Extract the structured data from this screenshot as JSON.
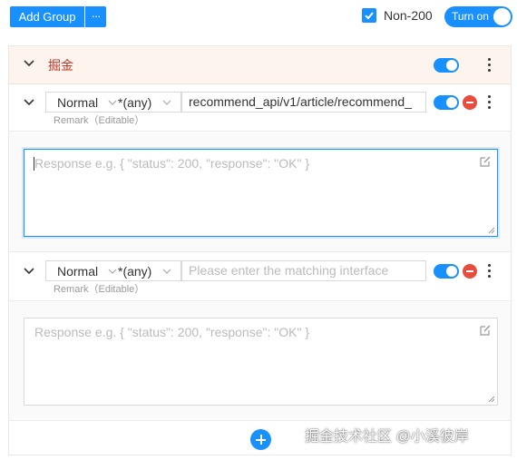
{
  "toolbar": {
    "add_group_label": "Add Group",
    "more_label": "···",
    "non200_label": "Non-200",
    "non200_checked": true,
    "turn_on_label": "Turn on",
    "turn_on_enabled": true
  },
  "group": {
    "title": "掘金",
    "enabled": true
  },
  "rules": [
    {
      "method": "Normal",
      "match_type": "*(any)",
      "url_value": "recommend_api/v1/article/recommend_",
      "url_placeholder": "Please enter the matching interface",
      "remark": "Remark（Editable）",
      "enabled": true,
      "response_placeholder": "Response  e.g. { \"status\": 200, \"response\": \"OK\" }",
      "focused": true
    },
    {
      "method": "Normal",
      "match_type": "*(any)",
      "url_value": "",
      "url_placeholder": "Please enter the matching interface",
      "remark": "Remark（Editable）",
      "enabled": true,
      "response_placeholder": "Response  e.g. { \"status\": 200, \"response\": \"OK\" }",
      "focused": false
    }
  ],
  "watermark": "掘金技术社区 @小溪彼岸",
  "colors": {
    "accent": "#1890ff",
    "group_title": "#c0392b",
    "group_header_bg": "#fdf4ee",
    "delete": "#e74c3c"
  },
  "icons": [
    "check-icon",
    "chevron-down-icon",
    "kebab-icon",
    "delete-icon",
    "edit-icon",
    "resize-grip-icon",
    "add-icon"
  ]
}
